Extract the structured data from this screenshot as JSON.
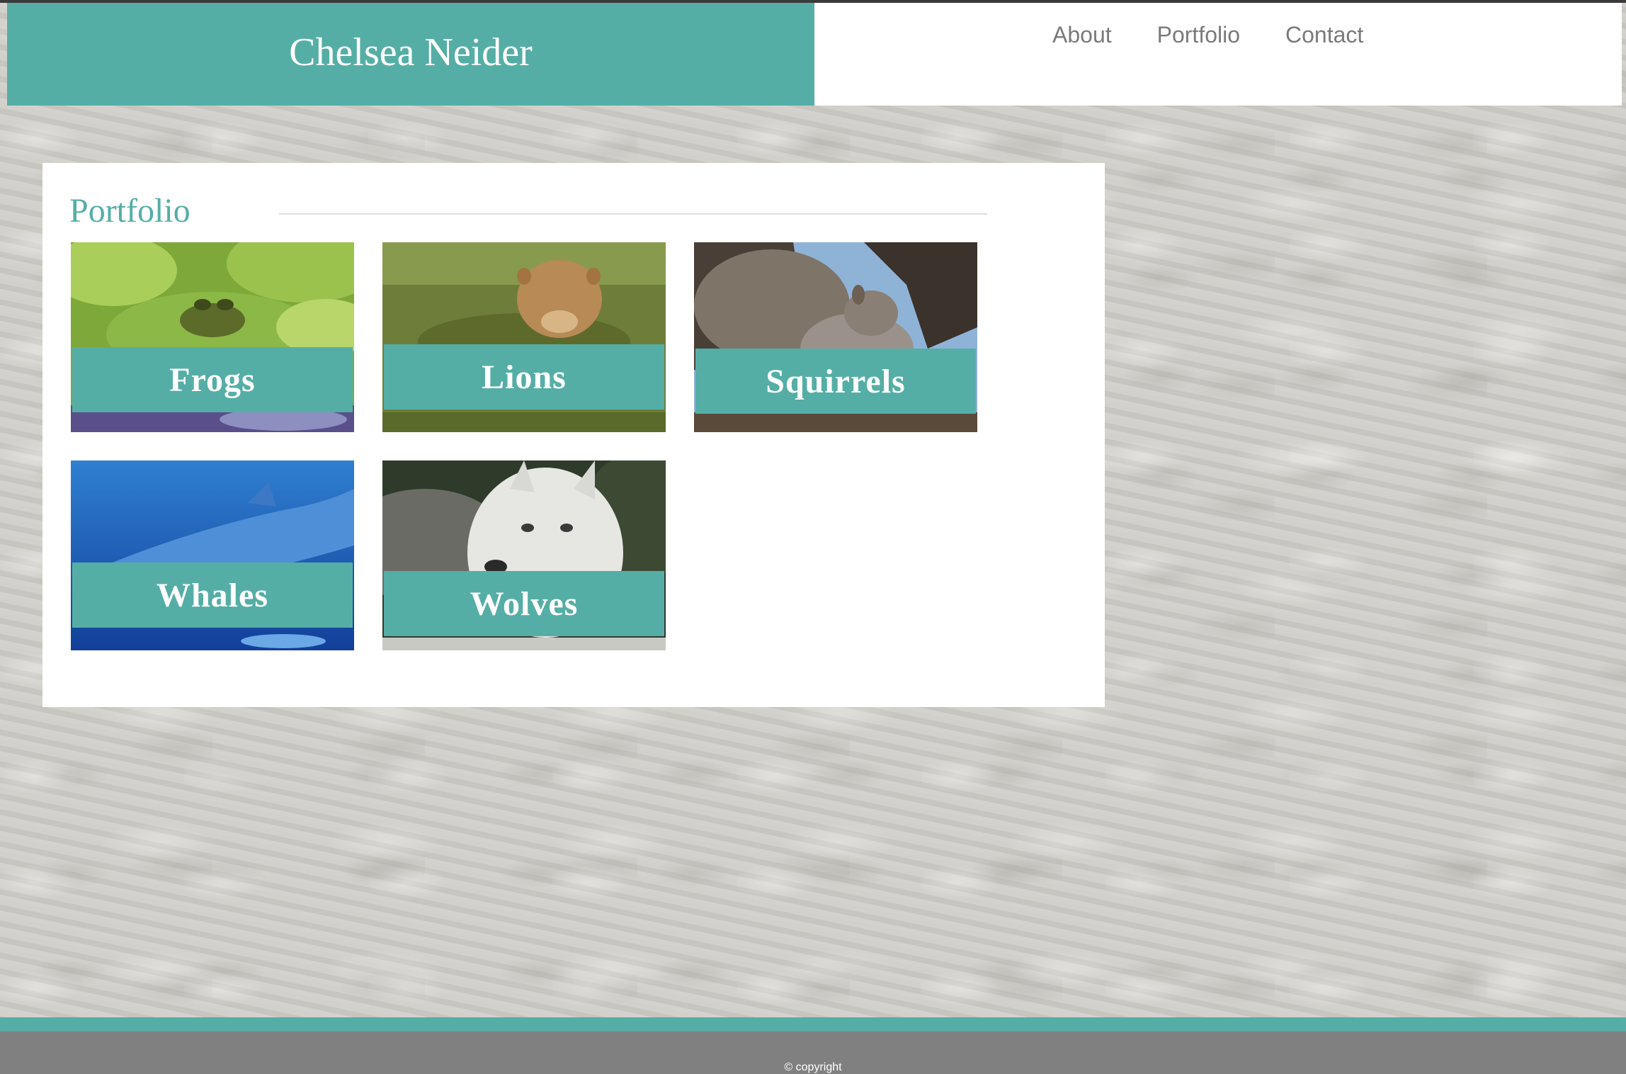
{
  "header": {
    "brand": "Chelsea Neider",
    "nav": [
      "About",
      "Portfolio",
      "Contact"
    ]
  },
  "portfolio": {
    "title": "Portfolio",
    "items": [
      {
        "label": "Frogs",
        "icon": "frog-on-lily-pad-image"
      },
      {
        "label": "Lions",
        "icon": "lioness-image"
      },
      {
        "label": "Squirrels",
        "icon": "squirrel-image"
      },
      {
        "label": "Whales",
        "icon": "whale-image"
      },
      {
        "label": "Wolves",
        "icon": "wolf-image"
      }
    ]
  },
  "footer": {
    "copyright": "© copyright"
  },
  "colors": {
    "accent": "#55aea6",
    "footer": "#808080",
    "nav_text": "#7a7a7a"
  }
}
